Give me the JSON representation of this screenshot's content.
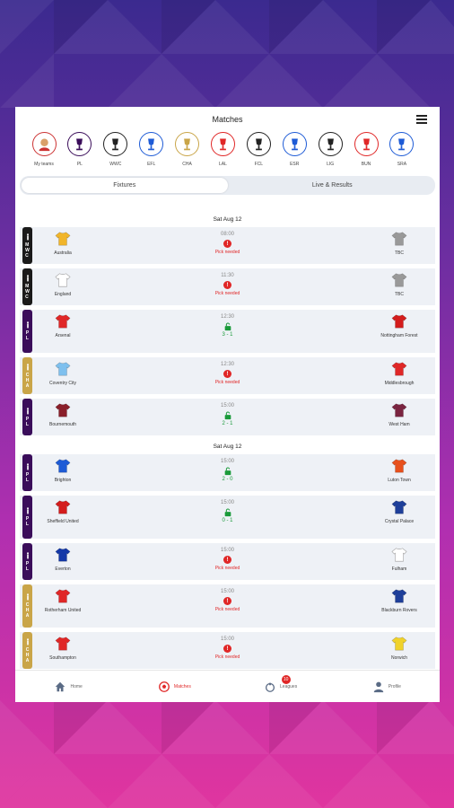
{
  "header": {
    "title": "Matches"
  },
  "leagues": [
    {
      "label": "My teams",
      "icon": "avatar-icon",
      "color": "#c33"
    },
    {
      "label": "PL",
      "icon": "pl-icon",
      "color": "#3a0d5a"
    },
    {
      "label": "WWC",
      "icon": "wwc-icon",
      "color": "#222"
    },
    {
      "label": "EFL",
      "icon": "efl-icon",
      "color": "#1e5bd6"
    },
    {
      "label": "CHA",
      "icon": "cha-icon",
      "color": "#c9a548"
    },
    {
      "label": "LAL",
      "icon": "lal-icon",
      "color": "#e02727"
    },
    {
      "label": "FCL",
      "icon": "fcl-icon",
      "color": "#222"
    },
    {
      "label": "ESR",
      "icon": "esr-icon",
      "color": "#1e5bd6"
    },
    {
      "label": "LIG",
      "icon": "lig-icon",
      "color": "#222"
    },
    {
      "label": "BUN",
      "icon": "bun-icon",
      "color": "#e02727"
    },
    {
      "label": "SRA",
      "icon": "sra-icon",
      "color": "#1e5bd6"
    }
  ],
  "tabs": {
    "fixtures": "Fixtures",
    "results": "Live & Results"
  },
  "sections": [
    {
      "date": "Sat Aug 12",
      "matches": [
        {
          "tag": "MWC",
          "tagclass": "wwc",
          "home": "Australia",
          "away": "TBC",
          "time": "08:00",
          "state": "pick",
          "status": "Pick needed",
          "home_color": "#f1b52a",
          "away_color": "#999"
        },
        {
          "tag": "MWC",
          "tagclass": "wwc",
          "home": "England",
          "away": "TBC",
          "time": "11:30",
          "state": "pick",
          "status": "Pick needed",
          "home_color": "#ffffff",
          "away_color": "#999"
        },
        {
          "tag": "PL",
          "tagclass": "pl",
          "home": "Arsenal",
          "away": "Nottingham Forest",
          "time": "12:30",
          "state": "open",
          "score": "3 - 1",
          "home_color": "#e02727",
          "away_color": "#d41c1c"
        },
        {
          "tag": "CHA",
          "tagclass": "cha",
          "home": "Coventry City",
          "away": "Middlesbrough",
          "time": "12:30",
          "state": "pick",
          "status": "Pick needed",
          "home_color": "#7ec0ee",
          "away_color": "#e02727"
        },
        {
          "tag": "PL",
          "tagclass": "pl",
          "home": "Bournemouth",
          "away": "West Ham",
          "time": "15:00",
          "state": "open",
          "score": "2 - 1",
          "home_color": "#8a1f2a",
          "away_color": "#7a2440"
        }
      ]
    },
    {
      "date": "Sat Aug 12",
      "matches": [
        {
          "tag": "PL",
          "tagclass": "pl",
          "home": "Brighton",
          "away": "Luton Town",
          "time": "15:00",
          "state": "open",
          "score": "2 - 0",
          "home_color": "#1e5bd6",
          "away_color": "#e8501c"
        },
        {
          "tag": "PL",
          "tagclass": "pl",
          "home": "Sheffield United",
          "away": "Crystal Palace",
          "time": "15:00",
          "state": "open",
          "score": "0 - 1",
          "home_color": "#d41c1c",
          "away_color": "#1e3f9a"
        },
        {
          "tag": "PL",
          "tagclass": "pl",
          "home": "Everton",
          "away": "Fulham",
          "time": "15:00",
          "state": "pick",
          "status": "Pick needed",
          "home_color": "#1438a8",
          "away_color": "#ffffff"
        },
        {
          "tag": "CHA",
          "tagclass": "cha",
          "home": "Rotherham United",
          "away": "Blackburn Rovers",
          "time": "15:00",
          "state": "pick",
          "status": "Pick needed",
          "home_color": "#e02727",
          "away_color": "#1e3f9a"
        },
        {
          "tag": "CHA",
          "tagclass": "cha",
          "home": "Southampton",
          "away": "Norwich",
          "time": "15:00",
          "state": "pick",
          "status": "Pick needed",
          "home_color": "#e02727",
          "away_color": "#f0d22a"
        }
      ]
    }
  ],
  "nav": {
    "home": "Home",
    "matches": "Matches",
    "leagues": "Leagues",
    "leagues_badge": "10",
    "profile": "Profile"
  },
  "colors": {
    "accent": "#e02727",
    "green": "#1a9a3a"
  }
}
